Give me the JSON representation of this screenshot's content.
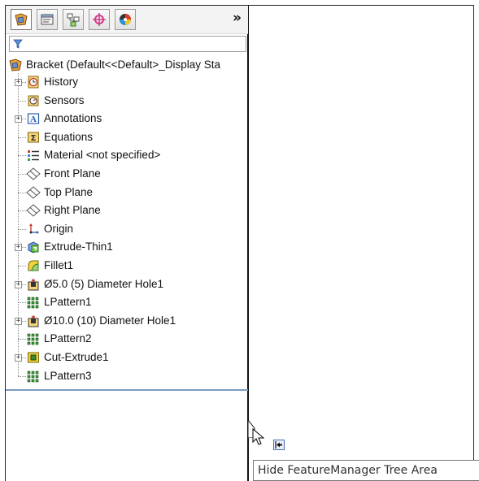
{
  "feature_manager": {
    "tabs": [
      {
        "name": "featuremanager-tab",
        "icon": "featuremanager-icon"
      },
      {
        "name": "propertymanager-tab",
        "icon": "propertymanager-icon"
      },
      {
        "name": "configurationmanager-tab",
        "icon": "configurationmanager-icon"
      },
      {
        "name": "dimxpertmanager-tab",
        "icon": "dimxpertmanager-icon"
      },
      {
        "name": "displaymanager-tab",
        "icon": "displaymanager-icon"
      }
    ],
    "more_label": "»",
    "filter_icon": "filter-icon",
    "root_label": "Bracket  (Default<<Default>_Display Sta",
    "items": [
      {
        "label": "History",
        "icon": "history-icon",
        "expandable": true
      },
      {
        "label": "Sensors",
        "icon": "sensors-icon",
        "expandable": false
      },
      {
        "label": "Annotations",
        "icon": "annotations-icon",
        "expandable": true
      },
      {
        "label": "Equations",
        "icon": "equations-icon",
        "expandable": false
      },
      {
        "label": "Material <not specified>",
        "icon": "material-icon",
        "expandable": false
      },
      {
        "label": "Front Plane",
        "icon": "plane-icon",
        "expandable": false
      },
      {
        "label": "Top Plane",
        "icon": "plane-icon",
        "expandable": false
      },
      {
        "label": "Right Plane",
        "icon": "plane-icon",
        "expandable": false
      },
      {
        "label": "Origin",
        "icon": "origin-icon",
        "expandable": false
      },
      {
        "label": "Extrude-Thin1",
        "icon": "extrude-icon",
        "expandable": true
      },
      {
        "label": "Fillet1",
        "icon": "fillet-icon",
        "expandable": false
      },
      {
        "label": "Ø5.0 (5) Diameter Hole1",
        "icon": "hole-icon",
        "expandable": true
      },
      {
        "label": "LPattern1",
        "icon": "linear-pattern-icon",
        "expandable": false
      },
      {
        "label": "Ø10.0 (10) Diameter Hole1",
        "icon": "hole-icon",
        "expandable": true
      },
      {
        "label": "LPattern2",
        "icon": "linear-pattern-icon",
        "expandable": false
      },
      {
        "label": "Cut-Extrude1",
        "icon": "cut-extrude-icon",
        "expandable": true
      },
      {
        "label": "LPattern3",
        "icon": "linear-pattern-icon",
        "expandable": false
      }
    ]
  },
  "tooltip": {
    "text": "Hide FeatureManager Tree Area"
  },
  "colors": {
    "accent": "#3a6fc4",
    "tree_end_line": "#7a9cc4"
  }
}
